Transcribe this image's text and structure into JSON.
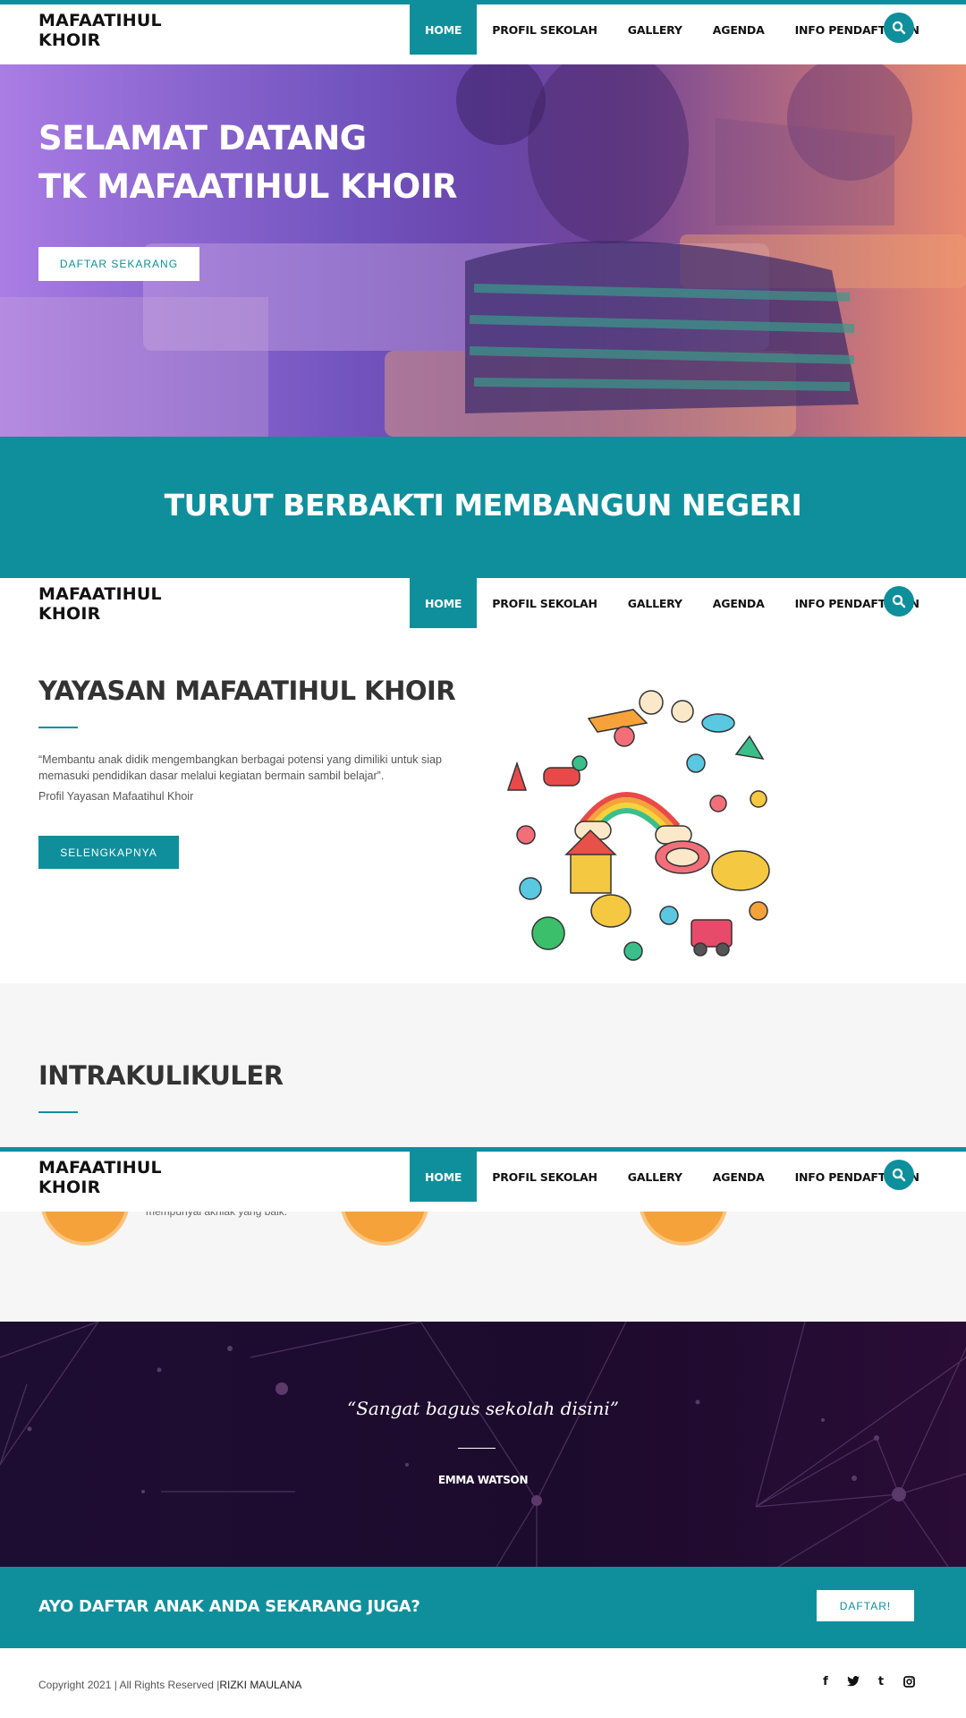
{
  "brand": {
    "line1": "MAFAATIHUL",
    "line2": "KHOIR"
  },
  "nav": {
    "items": [
      {
        "label": "HOME",
        "active": true
      },
      {
        "label": "PROFIL SEKOLAH"
      },
      {
        "label": "GALLERY"
      },
      {
        "label": "AGENDA"
      },
      {
        "label": "INFO PENDAFTARAN"
      }
    ],
    "search_icon": "search-icon"
  },
  "hero": {
    "title_line1": "SELAMAT DATANG",
    "title_line2": "TK MAFAATIHUL KHOIR",
    "button": "DAFTAR SEKARANG"
  },
  "tagline": "TURUT BERBAKTI MEMBANGUN NEGERI",
  "about": {
    "title": "YAYASAN MAFAATIHUL KHOIR",
    "quote": "“Membantu anak didik mengembangkan berbagai potensi yang dimiliki untuk siap memasuki pendidikan dasar melalui kegiatan bermain sambil belajar”.",
    "caption": "Profil Yayasan Mafaatihul Khoir",
    "button": "SELENGKAPNYA"
  },
  "intra": {
    "title": "INTRAKULIKULER",
    "partial_text": "mempunyai akhlak yang baik."
  },
  "testimonial": {
    "quote": "“Sangat bagus sekolah disini”",
    "name": "EMMA WATSON"
  },
  "cta": {
    "title": "AYO DAFTAR ANAK ANDA SEKARANG JUGA?",
    "button": "DAFTAR!"
  },
  "footer": {
    "copyright": "Copyright 2021 | All Rights Reserved |",
    "author": "RIZKI MAULANA",
    "socials": [
      "facebook-icon",
      "twitter-icon",
      "tumblr-icon",
      "instagram-icon"
    ]
  },
  "colors": {
    "accent": "#0f8f9c",
    "orange": "#f5a23b",
    "dark": "#1e0d33"
  }
}
